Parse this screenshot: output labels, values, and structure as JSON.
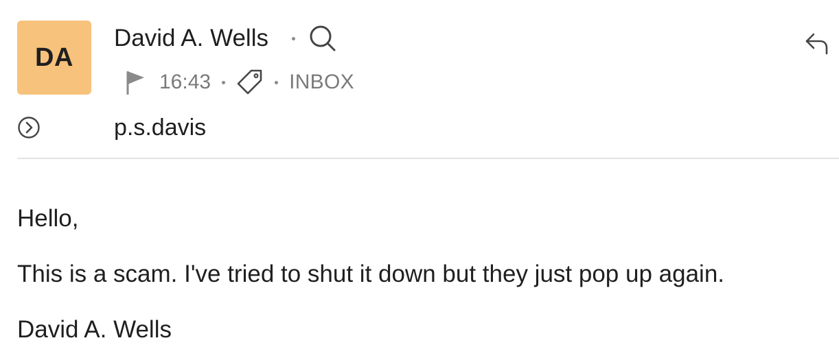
{
  "message": {
    "avatar_initials": "DA",
    "avatar_color": "#f6c27c",
    "sender_name": "David A. Wells",
    "time": "16:43",
    "folder": "INBOX",
    "recipient": "p.s.davis",
    "body": {
      "greeting": "Hello,",
      "text": "This is a scam. I've tried to shut it down but they just pop up again.",
      "signature": "David A. Wells"
    }
  },
  "icons": {
    "search": "search-icon",
    "flag": "flag-icon",
    "tag": "tag-icon",
    "reply": "reply-icon",
    "expand": "chevron-right-circle-icon"
  }
}
